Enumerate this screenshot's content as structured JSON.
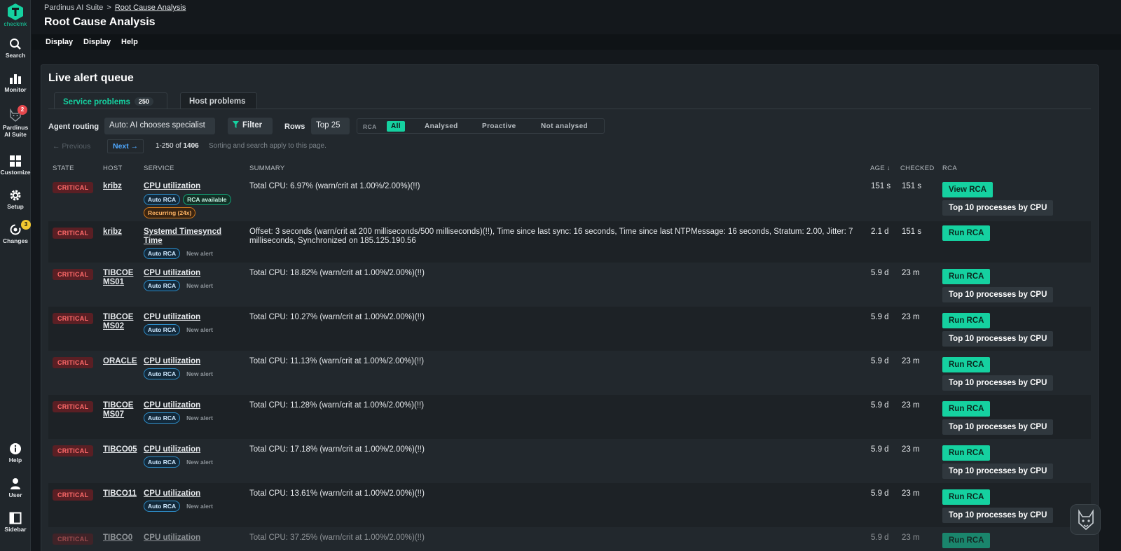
{
  "app": {
    "logo_text": "checkmk"
  },
  "nav": {
    "search": "Search",
    "monitor": "Monitor",
    "pardinus": "Pardinus AI Suite",
    "pardinus_badge": "2",
    "customize": "Customize",
    "setup": "Setup",
    "changes": "Changes",
    "changes_badge": "3",
    "help": "Help",
    "user": "User",
    "sidebar": "Sidebar"
  },
  "breadcrumb": {
    "root": "Pardinus AI Suite",
    "separator": ">",
    "current": "Root Cause Analysis"
  },
  "page_title": "Root Cause Analysis",
  "menubar": {
    "item1": "Display",
    "item2": "Display",
    "item3": "Help"
  },
  "queue": {
    "title": "Live alert queue",
    "tab_service": "Service problems",
    "tab_service_count": "250",
    "tab_host": "Host problems",
    "agent_routing_label": "Agent routing",
    "agent_routing_value": "Auto: AI chooses specialist",
    "filter_label": "Filter",
    "rows_label": "Rows",
    "rows_value": "Top 25",
    "rca_label": "RCA",
    "seg_all": "All",
    "seg_analysed": "Analysed",
    "seg_proactive": "Proactive",
    "seg_not_analysed": "Not analysed",
    "prev": "← Previous",
    "next": "Next →",
    "range": "1-250",
    "range_of": "of",
    "total": "1406",
    "note": "Sorting and search apply to this page."
  },
  "columns": {
    "state": "STATE",
    "host": "HOST",
    "service": "SERVICE",
    "summary": "SUMMARY",
    "age": "AGE ↓",
    "checked": "CHECKED",
    "rca": "RCA"
  },
  "rows": [
    {
      "state": "CRITICAL",
      "host": "kribz",
      "service": "CPU utilization",
      "tag1": "Auto RCA",
      "tag2": "RCA available",
      "tag3": "Recurring (24x)",
      "summary": "Total CPU: 6.97% (warn/crit at 1.00%/2.00%)(!!)",
      "age": "151 s",
      "checked": "151 s",
      "action": "View RCA",
      "top": "Top 10 processes by CPU"
    },
    {
      "state": "CRITICAL",
      "host": "kribz",
      "service": "Systemd Timesyncd Time",
      "tag1": "Auto RCA",
      "tag2": "New alert",
      "summary": "Offset: 3 seconds (warn/crit at 200 milliseconds/500 milliseconds)(!!), Time since last sync: 16 seconds, Time since last NTPMessage: 16 seconds, Stratum: 2.00, Jitter: 7 milliseconds, Synchronized on 185.125.190.56",
      "age": "2.1 d",
      "checked": "151 s",
      "action": "Run RCA"
    },
    {
      "state": "CRITICAL",
      "host": "TIBCOEMS01",
      "service": "CPU utilization",
      "tag1": "Auto RCA",
      "tag2": "New alert",
      "summary": "Total CPU: 18.82% (warn/crit at 1.00%/2.00%)(!!)",
      "age": "5.9 d",
      "checked": "23 m",
      "action": "Run RCA",
      "top": "Top 10 processes by CPU"
    },
    {
      "state": "CRITICAL",
      "host": "TIBCOEMS02",
      "service": "CPU utilization",
      "tag1": "Auto RCA",
      "tag2": "New alert",
      "summary": "Total CPU: 10.27% (warn/crit at 1.00%/2.00%)(!!)",
      "age": "5.9 d",
      "checked": "23 m",
      "action": "Run RCA",
      "top": "Top 10 processes by CPU"
    },
    {
      "state": "CRITICAL",
      "host": "ORACLE",
      "service": "CPU utilization",
      "tag1": "Auto RCA",
      "tag2": "New alert",
      "summary": "Total CPU: 11.13% (warn/crit at 1.00%/2.00%)(!!)",
      "age": "5.9 d",
      "checked": "23 m",
      "action": "Run RCA",
      "top": "Top 10 processes by CPU"
    },
    {
      "state": "CRITICAL",
      "host": "TIBCOEMS07",
      "service": "CPU utilization",
      "tag1": "Auto RCA",
      "tag2": "New alert",
      "summary": "Total CPU: 11.28% (warn/crit at 1.00%/2.00%)(!!)",
      "age": "5.9 d",
      "checked": "23 m",
      "action": "Run RCA",
      "top": "Top 10 processes by CPU"
    },
    {
      "state": "CRITICAL",
      "host": "TIBCO05",
      "service": "CPU utilization",
      "tag1": "Auto RCA",
      "tag2": "New alert",
      "summary": "Total CPU: 17.18% (warn/crit at 1.00%/2.00%)(!!)",
      "age": "5.9 d",
      "checked": "23 m",
      "action": "Run RCA",
      "top": "Top 10 processes by CPU"
    },
    {
      "state": "CRITICAL",
      "host": "TIBCO11",
      "service": "CPU utilization",
      "tag1": "Auto RCA",
      "tag2": "New alert",
      "summary": "Total CPU: 13.61% (warn/crit at 1.00%/2.00%)(!!)",
      "age": "5.9 d",
      "checked": "23 m",
      "action": "Run RCA",
      "top": "Top 10 processes by CPU"
    },
    {
      "state": "CRITICAL",
      "host": "TIBCO0",
      "service": "CPU utilization",
      "summary": "Total CPU: 37.25% (warn/crit at 1.00%/2.00%)(!!)",
      "age": "5.9 d",
      "checked": "23 m",
      "action": "Run RCA"
    }
  ],
  "colors": {
    "accent": "#15d1a0",
    "critical_bg": "#5a1f24",
    "critical_fg": "#ff6a6a",
    "link": "#4fa8ff"
  }
}
